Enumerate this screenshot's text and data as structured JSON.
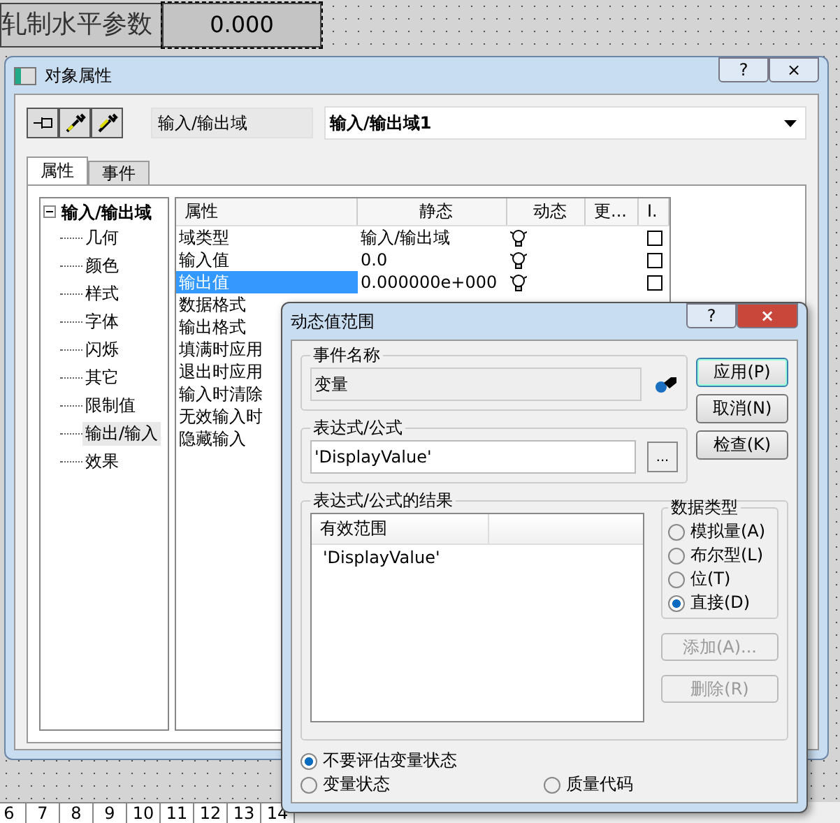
{
  "canvas": {
    "label": "轧制水平参数",
    "value": "0.000",
    "page_tabs": [
      "6",
      "7",
      "8",
      "9",
      "10",
      "11",
      "12",
      "13",
      "14"
    ]
  },
  "window": {
    "title": "对象属性",
    "help": "?",
    "close": "×",
    "object_type": "输入/输出域",
    "object_name": "输入/输出域1",
    "tabs": [
      {
        "label": "属性",
        "selected": true
      },
      {
        "label": "事件",
        "selected": false
      }
    ],
    "tree": {
      "label": "输入/输出域",
      "expanded": true,
      "children": [
        {
          "label": "几何",
          "selected": false
        },
        {
          "label": "颜色",
          "selected": false
        },
        {
          "label": "样式",
          "selected": false
        },
        {
          "label": "字体",
          "selected": false
        },
        {
          "label": "闪烁",
          "selected": false
        },
        {
          "label": "其它",
          "selected": false
        },
        {
          "label": "限制值",
          "selected": false
        },
        {
          "label": "输出/输入",
          "selected": true
        },
        {
          "label": "效果",
          "selected": false
        }
      ]
    },
    "grid": {
      "columns": [
        "属性",
        "静态",
        "动态",
        "更...",
        "I."
      ],
      "rows": [
        {
          "name": "域类型",
          "static": "输入/输出域",
          "dynamic": true,
          "checked": false,
          "selected": false
        },
        {
          "name": "输入值",
          "static": "0.0",
          "dynamic": true,
          "checked": false,
          "selected": false
        },
        {
          "name": "输出值",
          "static": "0.000000e+000",
          "dynamic": true,
          "checked": false,
          "selected": true
        },
        {
          "name": "数据格式",
          "selected": false
        },
        {
          "name": "输出格式",
          "selected": false
        },
        {
          "name": "填满时应用",
          "selected": false
        },
        {
          "name": "退出时应用",
          "selected": false
        },
        {
          "name": "输入时清除",
          "selected": false
        },
        {
          "name": "无效输入时",
          "selected": false
        },
        {
          "name": "隐藏输入",
          "selected": false
        }
      ]
    }
  },
  "dialog": {
    "title": "动态值范围",
    "help": "?",
    "close": "×",
    "event_group": "事件名称",
    "event_name": "变量",
    "expr_group": "表达式/公式",
    "expr_value": "'DisplayValue'",
    "browse": "...",
    "result_group": "表达式/公式的结果",
    "result_columns": [
      "有效范围"
    ],
    "result_rows": [
      "'DisplayValue'"
    ],
    "type_group": "数据类型",
    "types": [
      {
        "label": "模拟量(A)",
        "selected": false
      },
      {
        "label": "布尔型(L)",
        "selected": false
      },
      {
        "label": "位(T)",
        "selected": false
      },
      {
        "label": "直接(D)",
        "selected": true
      }
    ],
    "buttons": [
      {
        "label": "应用(P)",
        "disabled": false,
        "default": true
      },
      {
        "label": "取消(N)",
        "disabled": false,
        "default": false
      },
      {
        "label": "检查(K)",
        "disabled": false,
        "default": false
      }
    ],
    "list_buttons": [
      {
        "label": "添加(A)...",
        "disabled": true
      },
      {
        "label": "删除(R)",
        "disabled": true
      }
    ],
    "status_options": [
      {
        "label": "不要评估变量状态",
        "selected": true
      },
      {
        "label": "变量状态",
        "selected": false
      },
      {
        "label": "质量代码",
        "selected": false
      }
    ]
  }
}
